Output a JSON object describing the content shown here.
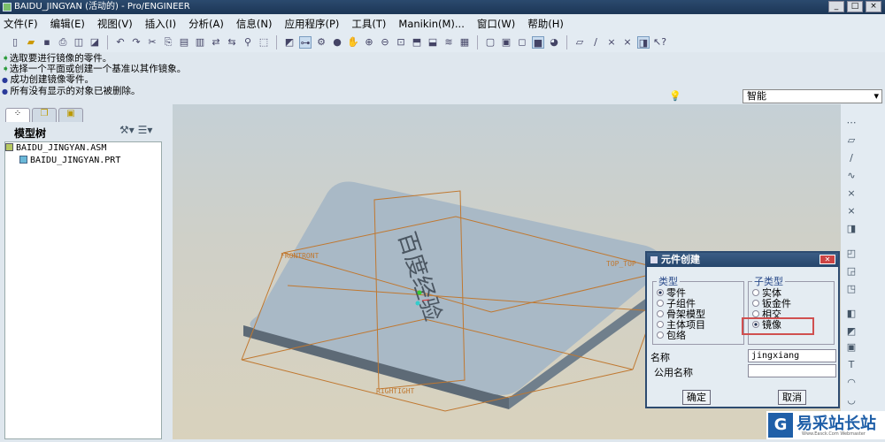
{
  "window": {
    "title": "BAIDU_JINGYAN (活动的) - Pro/ENGINEER"
  },
  "menu": [
    "文件(F)",
    "编辑(E)",
    "视图(V)",
    "插入(I)",
    "分析(A)",
    "信息(N)",
    "应用程序(P)",
    "工具(T)",
    "Manikin(M)...",
    "窗口(W)",
    "帮助(H)"
  ],
  "messages": [
    {
      "type": "prompt",
      "text": "选取要进行镜像的零件。"
    },
    {
      "type": "prompt",
      "text": "选择一个平面或创建一个基准以其作镜象。"
    },
    {
      "type": "info",
      "text": "成功创建镜像零件。"
    },
    {
      "type": "info",
      "text": "所有没有显示的对象已被删除。"
    }
  ],
  "filter": {
    "value": "智能"
  },
  "model_tree": {
    "title": "模型树",
    "items": [
      {
        "label": "BAIDU_JINGYAN.ASM"
      },
      {
        "label": "BAIDU_JINGYAN.PRT"
      }
    ]
  },
  "viewport": {
    "datum_labels": [
      "FRONTRONT",
      "TOP_TOP",
      "RIGHTIGHT"
    ],
    "model_text": "百度经验"
  },
  "dialog": {
    "title": "元件创建",
    "type_legend": "类型",
    "types": [
      {
        "label": "零件",
        "selected": true
      },
      {
        "label": "子组件",
        "selected": false
      },
      {
        "label": "骨架模型",
        "selected": false
      },
      {
        "label": "主体项目",
        "selected": false
      },
      {
        "label": "包络",
        "selected": false
      }
    ],
    "subtype_legend": "子类型",
    "subtypes": [
      {
        "label": "实体",
        "selected": false
      },
      {
        "label": "钣金件",
        "selected": false
      },
      {
        "label": "相交",
        "selected": false
      },
      {
        "label": "镜像",
        "selected": true
      }
    ],
    "name_label": "名称",
    "name_value": "jingxiang",
    "common_name_label": "公用名称",
    "common_name_value": "",
    "ok": "确定",
    "cancel": "取消"
  },
  "watermark": {
    "text": "易采站长站",
    "subtext": "Www.Easck.Com Webmaster"
  },
  "colors": {
    "titlebar": "#1c3656",
    "highlight": "#d05050",
    "datum": "#c07830",
    "model": "#a9b9c6"
  }
}
